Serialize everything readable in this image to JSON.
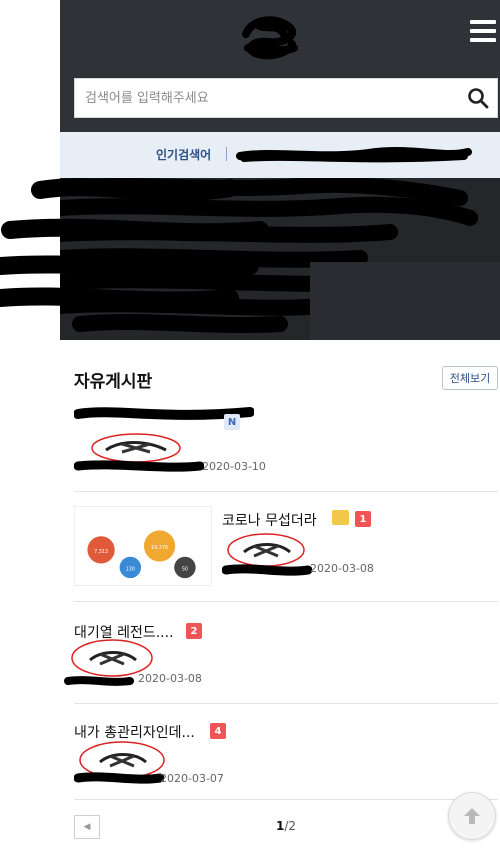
{
  "search": {
    "placeholder": "검색어를 입력해주세요"
  },
  "icons": {
    "menu": "hamburger-menu-icon",
    "search": "search-icon",
    "top": "arrow-up-icon",
    "file": "download-file-icon",
    "prev": "chevron-left-icon"
  },
  "popular": {
    "label": "인기검색어"
  },
  "board": {
    "title": "자유게시판",
    "view_all": "전체보기",
    "posts": [
      {
        "title": "",
        "badge": "N",
        "date": "2020-03-10"
      },
      {
        "title": "코로나 무섭더라",
        "badge": "1",
        "date": "2020-03-08"
      },
      {
        "title": "대기열 레전드....",
        "badge": "2",
        "date": "2020-03-08"
      },
      {
        "title": "내가 총관리자인데...",
        "badge": "4",
        "date": "2020-03-07"
      }
    ]
  },
  "thumbnail": {
    "circles": [
      {
        "label": "확진환자",
        "value": "7,313",
        "color": "#e05a3a"
      },
      {
        "label": "검사진행",
        "value": "19,376",
        "color": "#f0a830"
      },
      {
        "label": "격리해제",
        "value": "130",
        "color": "#3a8ad6"
      },
      {
        "label": "사망자",
        "value": "50",
        "color": "#444444"
      }
    ]
  },
  "pagination": {
    "current": "1",
    "total": "/2"
  },
  "colors": {
    "header": "#2f3237",
    "accent_red": "#f05454",
    "link_blue": "#2c4f86"
  }
}
